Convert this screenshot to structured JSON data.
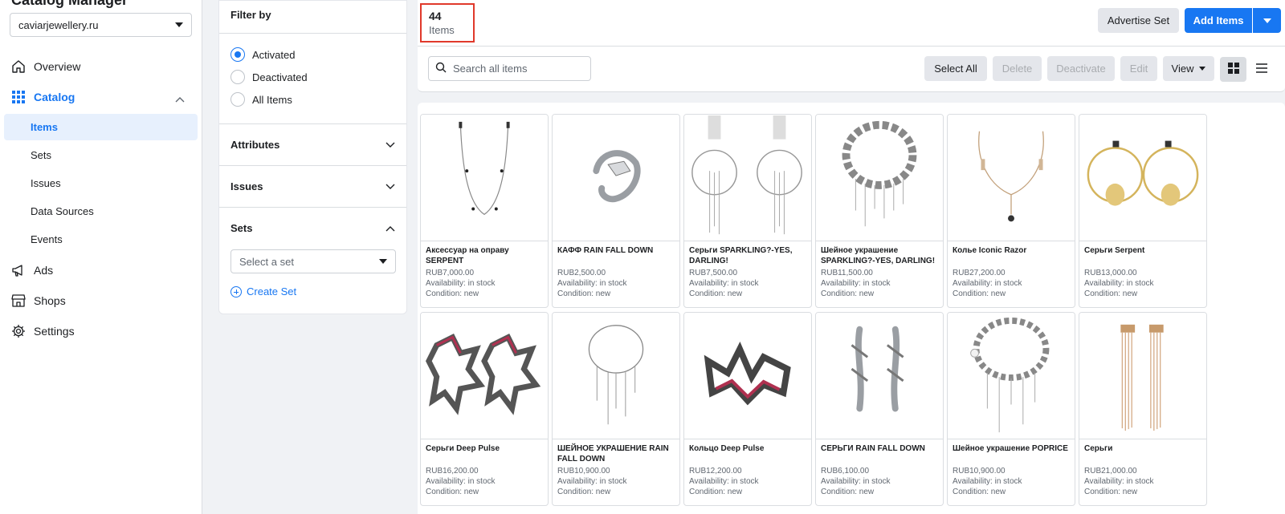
{
  "sidebar": {
    "app_title_partial": "Catalog Manager",
    "domain": "caviarjewellery.ru",
    "nav": [
      {
        "label": "Overview",
        "icon": "home-icon"
      },
      {
        "label": "Catalog",
        "icon": "grid-icon"
      },
      {
        "label": "Ads",
        "icon": "megaphone-icon"
      },
      {
        "label": "Shops",
        "icon": "storefront-icon"
      },
      {
        "label": "Settings",
        "icon": "gear-icon"
      }
    ],
    "catalog_sub": [
      "Items",
      "Sets",
      "Issues",
      "Data Sources",
      "Events"
    ]
  },
  "filter": {
    "title": "Filter by",
    "radios": [
      "Activated",
      "Deactivated",
      "All Items"
    ],
    "selected_radio": "Activated",
    "sections": [
      "Attributes",
      "Issues",
      "Sets"
    ],
    "set_placeholder": "Select a set",
    "create_set": "Create Set"
  },
  "header": {
    "count": "44",
    "count_label": "Items",
    "advertise_set": "Advertise Set",
    "add_items": "Add Items"
  },
  "toolbar": {
    "search_placeholder": "Search all items",
    "select_all": "Select All",
    "delete": "Delete",
    "deactivate": "Deactivate",
    "edit": "Edit",
    "view": "View"
  },
  "colors": {
    "accent": "#1877f2",
    "highlight_box": "#e0392b"
  },
  "items": [
    {
      "name": "Аксессуар на оправу SERPENT",
      "price": "RUB7,000.00",
      "availability": "Availability: in stock",
      "condition": "Condition: new"
    },
    {
      "name": "КАФФ RAIN FALL DOWN",
      "price": "RUB2,500.00",
      "availability": "Availability: in stock",
      "condition": "Condition: new"
    },
    {
      "name": "Серьги SPARKLING?-YES, DARLING!",
      "price": "RUB7,500.00",
      "availability": "Availability: in stock",
      "condition": "Condition: new"
    },
    {
      "name": "Шейное украшение SPARKLING?-YES, DARLING!",
      "price": "RUB11,500.00",
      "availability": "Availability: in stock",
      "condition": "Condition: new"
    },
    {
      "name": "Колье Iconic Razor",
      "price": "RUB27,200.00",
      "availability": "Availability: in stock",
      "condition": "Condition: new"
    },
    {
      "name": "Серьги Serpent",
      "price": "RUB13,000.00",
      "availability": "Availability: in stock",
      "condition": "Condition: new"
    },
    {
      "name": "Серьги Deep Pulse",
      "price": "RUB16,200.00",
      "availability": "Availability: in stock",
      "condition": "Condition: new"
    },
    {
      "name": "ШЕЙНОЕ УКРАШЕНИЕ RAIN FALL DOWN",
      "price": "RUB10,900.00",
      "availability": "Availability: in stock",
      "condition": "Condition: new"
    },
    {
      "name": "Кольцо Deep Pulse",
      "price": "RUB12,200.00",
      "availability": "Availability: in stock",
      "condition": "Condition: new"
    },
    {
      "name": "СЕРЬГИ RAIN FALL DOWN",
      "price": "RUB6,100.00",
      "availability": "Availability: in stock",
      "condition": "Condition: new"
    },
    {
      "name": "Шейное украшение POPRICE",
      "price": "RUB10,900.00",
      "availability": "Availability: in stock",
      "condition": "Condition: new"
    },
    {
      "name": "Серьги",
      "price": "RUB21,000.00",
      "availability": "Availability: in stock",
      "condition": "Condition: new"
    }
  ]
}
